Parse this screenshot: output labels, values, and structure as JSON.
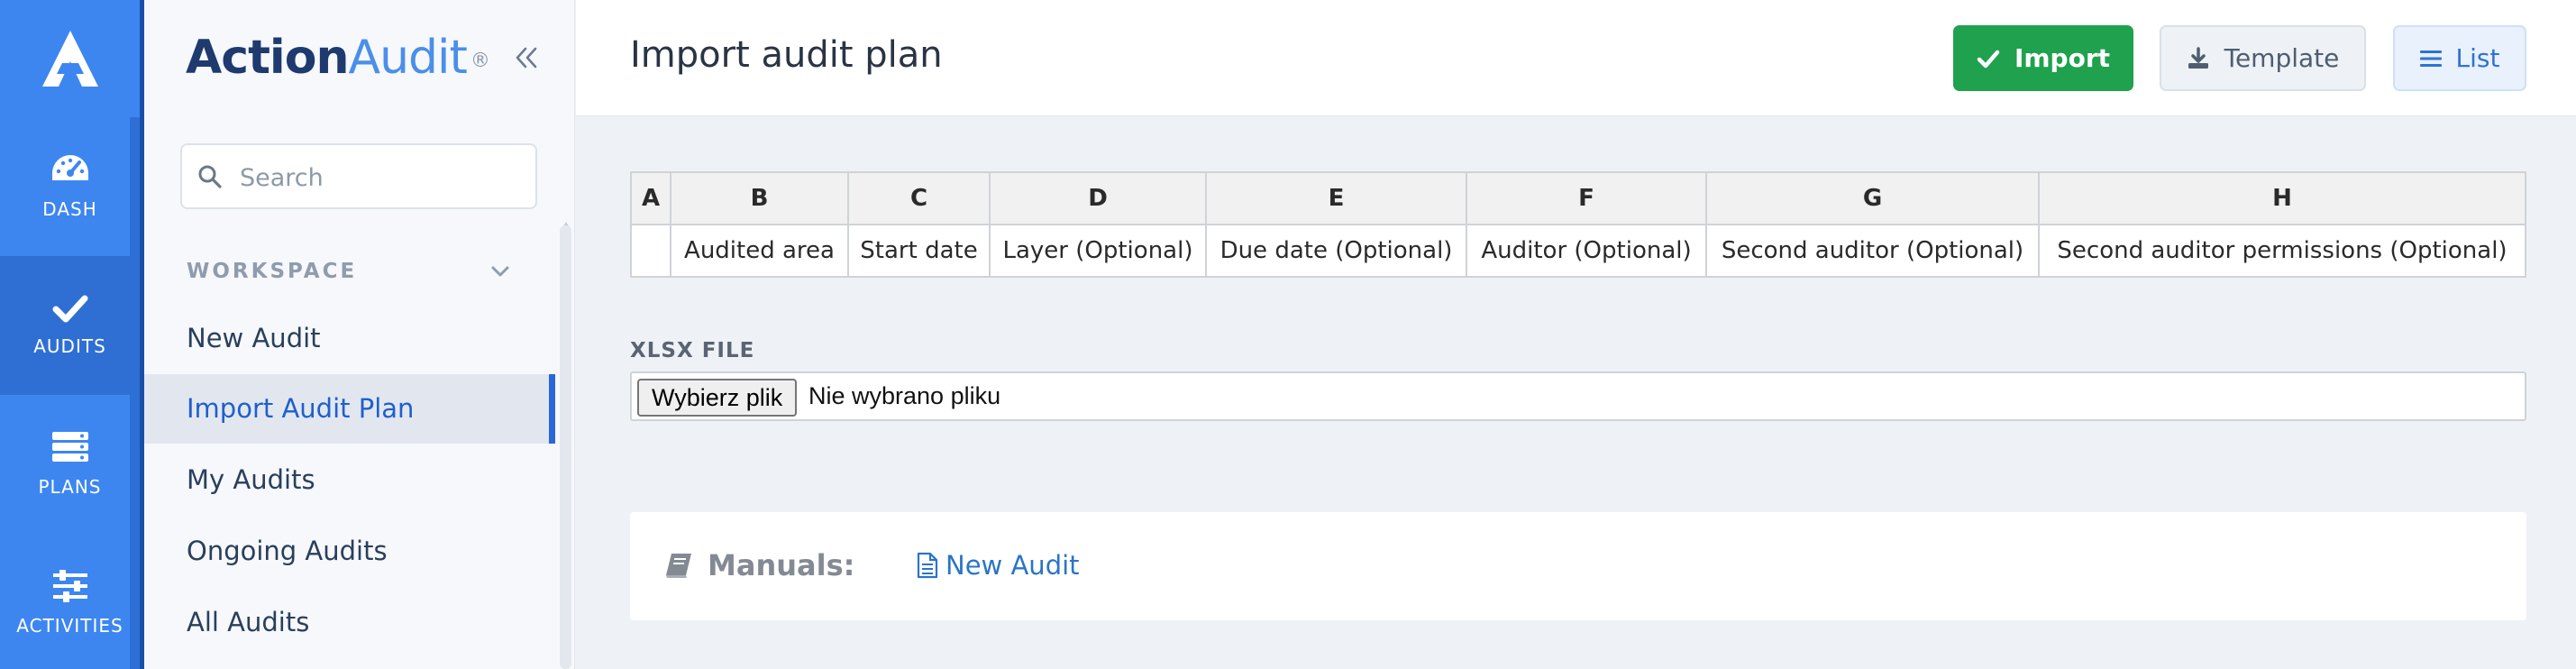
{
  "brand": {
    "name_part1": "Action",
    "name_part2": "Audit",
    "registered": "®"
  },
  "rail": {
    "items": [
      {
        "label": "DASH",
        "icon": "dashboard-icon"
      },
      {
        "label": "AUDITS",
        "icon": "check-icon",
        "active": true
      },
      {
        "label": "PLANS",
        "icon": "plans-icon"
      },
      {
        "label": "ACTIVITIES",
        "icon": "sliders-icon"
      }
    ]
  },
  "sidebar": {
    "search_placeholder": "Search",
    "section_title": "WORKSPACE",
    "items": [
      {
        "label": "New Audit"
      },
      {
        "label": "Import Audit Plan",
        "active": true
      },
      {
        "label": "My Audits"
      },
      {
        "label": "Ongoing Audits"
      },
      {
        "label": "All Audits"
      }
    ]
  },
  "header": {
    "title": "Import audit plan",
    "import_label": "Import",
    "template_label": "Template",
    "list_label": "List",
    "colors": {
      "import": "#1fa14e",
      "list": "#2e72d6"
    }
  },
  "columns_table": {
    "letters": [
      "A",
      "B",
      "C",
      "D",
      "E",
      "F",
      "G",
      "H"
    ],
    "names": [
      "",
      "Audited area",
      "Start date",
      "Layer (Optional)",
      "Due date (Optional)",
      "Auditor (Optional)",
      "Second auditor (Optional)",
      "Second auditor permissions (Optional)"
    ]
  },
  "file_upload": {
    "label": "XLSX FILE",
    "button_label": "Wybierz plik",
    "status": "Nie wybrano pliku"
  },
  "manuals": {
    "label": "Manuals:",
    "link": "New Audit"
  }
}
